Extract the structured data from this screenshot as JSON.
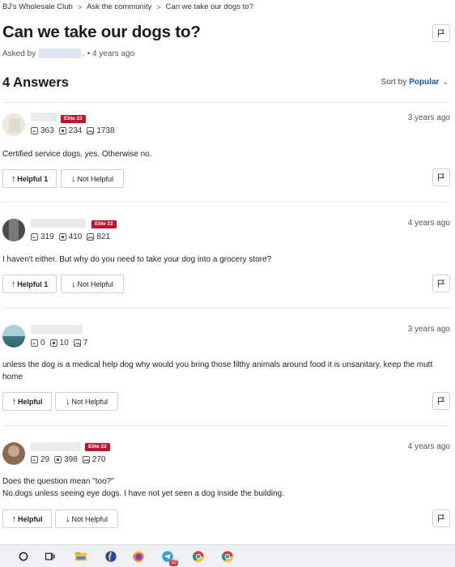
{
  "breadcrumb": [
    "BJ's Wholesale Club",
    "Ask the community",
    "Can we take our dogs to?"
  ],
  "question": {
    "title": "Can we take our dogs to?",
    "asked_prefix": "Asked by",
    "asked_suffix": ". • 4 years ago"
  },
  "answers_header": "4 Answers",
  "sort": {
    "label": "Sort by",
    "value": "Popular"
  },
  "answers": [
    {
      "badge": "Elite 22",
      "stats": {
        "questions": "363",
        "answers": "234",
        "photos": "1738"
      },
      "date": "3 years ago",
      "text": "Certified service dogs. yes. Otherwise no.",
      "helpful": "Helpful 1",
      "not_helpful": "Not Helpful"
    },
    {
      "badge": "Elite 22",
      "stats": {
        "questions": "319",
        "answers": "410",
        "photos": "821"
      },
      "date": "4 years ago",
      "text": "I haven't either. But why do you need to take your dog into a grocery store?",
      "helpful": "Helpful 1",
      "not_helpful": "Not Helpful"
    },
    {
      "badge": "",
      "stats": {
        "questions": "0",
        "answers": "10",
        "photos": "7"
      },
      "date": "3 years ago",
      "text": "unless the dog is a medical help dog why would you bring those filthy animals around food it is unsanitary. keep the mutt home",
      "helpful": "Helpful",
      "not_helpful": "Not Helpful"
    },
    {
      "badge": "Elite 22",
      "stats": {
        "questions": "29",
        "answers": "398",
        "photos": "270"
      },
      "date": "4 years ago",
      "text_lines": [
        "Does the question mean \"too?\"",
        "No.dogs unless seeing eye dogs. I have not yet seen a dog inside the building."
      ],
      "helpful": "Helpful",
      "not_helpful": "Not Helpful"
    }
  ],
  "taskbar": {
    "icons": [
      "search-circle-icon",
      "task-view-icon",
      "file-explorer-icon",
      "firefox-icon",
      "telegram-icon",
      "chrome-profile-icon",
      "chrome-profile-icon"
    ],
    "telegram_badge": "10"
  },
  "colors": {
    "accent": "#0a5fa8",
    "elite": "#c8102e"
  }
}
